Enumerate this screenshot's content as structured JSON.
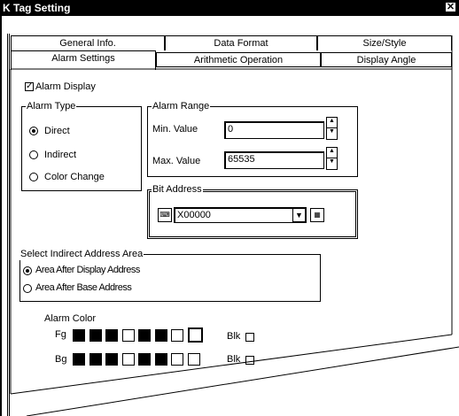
{
  "window": {
    "title": "K Tag Setting",
    "close_glyph": "✕"
  },
  "tabs": {
    "row1": [
      "General Info.",
      "Data Format",
      "Size/Style"
    ],
    "row2": [
      "Alarm Settings",
      "Arithmetic Operation",
      "Display Angle"
    ],
    "active": "Alarm Settings"
  },
  "alarm_display": {
    "label": "Alarm Display",
    "checked": true
  },
  "alarm_type": {
    "title": "Alarm Type",
    "options": [
      "Direct",
      "Indirect",
      "Color Change"
    ],
    "selected": "Direct"
  },
  "alarm_range": {
    "title": "Alarm Range",
    "min_label": "Min. Value",
    "min_value": "0",
    "max_label": "Max. Value",
    "max_value": "65535"
  },
  "bit_address": {
    "title": "Bit Address",
    "value": "X00000"
  },
  "indirect_area": {
    "title": "Select Indirect Address Area",
    "options": [
      "Area After Display Address",
      "Area After Base Address"
    ],
    "selected": "Area After Display Address"
  },
  "alarm_color": {
    "title": "Alarm Color",
    "fg_label": "Fg",
    "bg_label": "Bg",
    "blk_label": "Blk",
    "fg_colors": [
      "#000000",
      "#000000",
      "#000000",
      "#ffffff",
      "#000000",
      "#000000",
      "#ffffff",
      "#ffffff"
    ],
    "bg_colors": [
      "#000000",
      "#000000",
      "#000000",
      "#ffffff",
      "#000000",
      "#000000",
      "#ffffff",
      "#ffffff"
    ],
    "fg_blink": false,
    "bg_blink": false
  }
}
